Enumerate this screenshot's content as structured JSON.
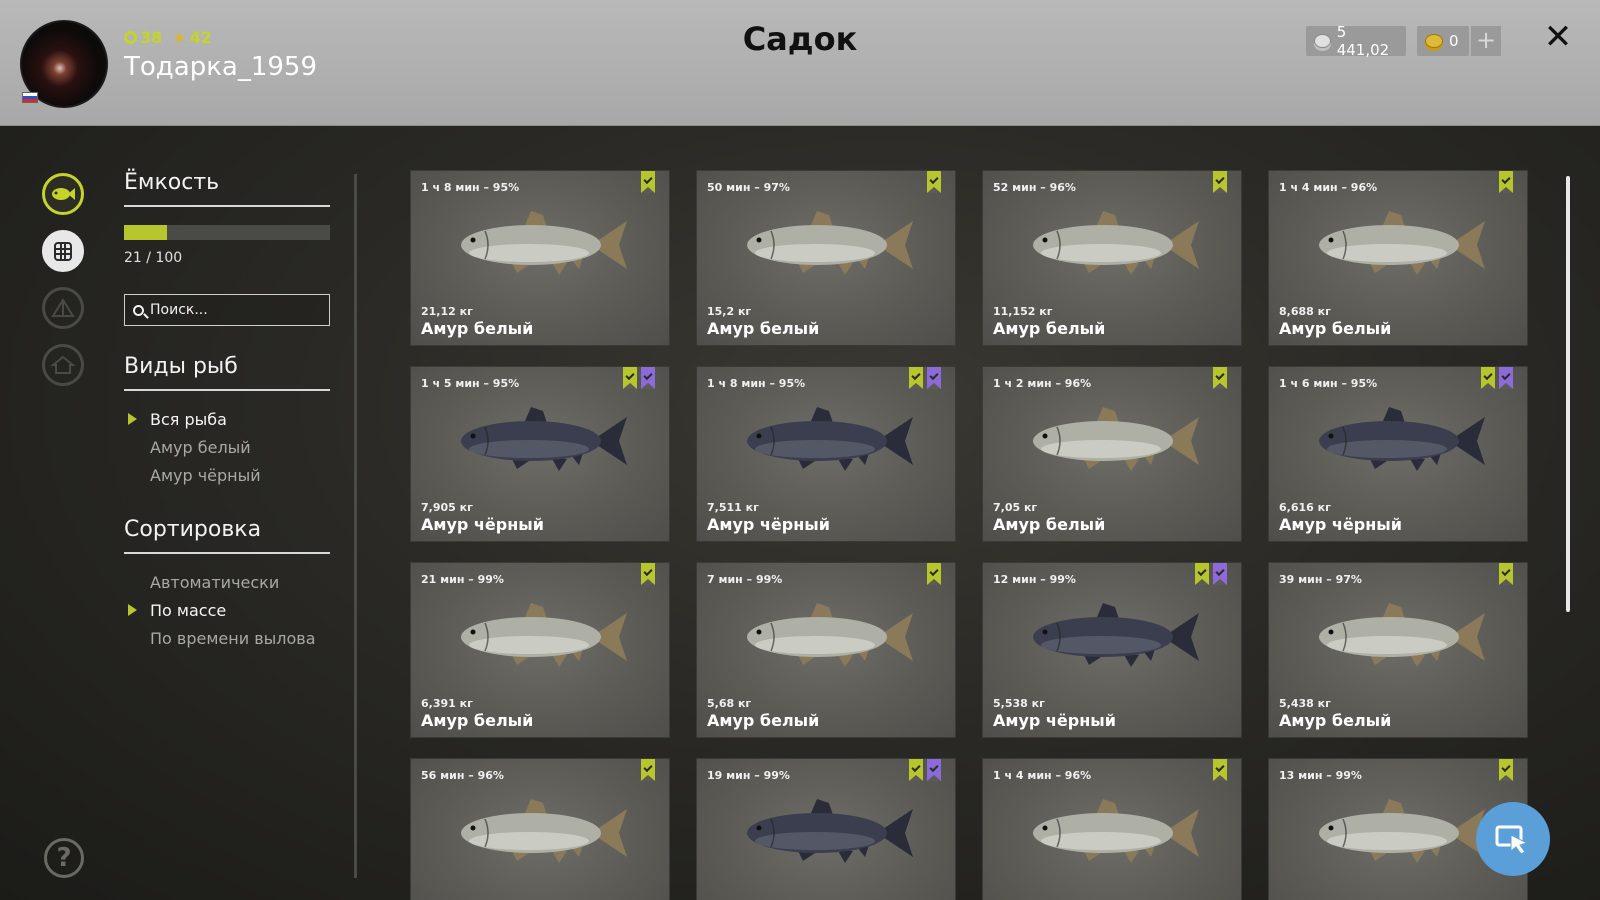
{
  "header": {
    "title": "Садок",
    "username": "Тодарка_1959",
    "level": "38",
    "rank": "42",
    "silver": "5 441,02",
    "gold": "0",
    "plus_label": "+",
    "close_label": "✕"
  },
  "capacity": {
    "title": "Ёмкость",
    "current": 21,
    "max": 100,
    "text": "21 / 100",
    "fill_fraction": 0.21
  },
  "search": {
    "placeholder": "Поиск..."
  },
  "species": {
    "title": "Виды рыб",
    "items": [
      {
        "label": "Вся рыба",
        "selected": true
      },
      {
        "label": "Амур белый",
        "selected": false
      },
      {
        "label": "Амур чёрный",
        "selected": false
      }
    ]
  },
  "sorting": {
    "title": "Сортировка",
    "items": [
      {
        "label": "Автоматически",
        "selected": false
      },
      {
        "label": "По массе",
        "selected": true
      },
      {
        "label": "По времени вылова",
        "selected": false
      }
    ]
  },
  "help_label": "?",
  "colors": {
    "accent": "#b6c62c",
    "purple_badge": "#8c6ad8",
    "fab": "#5a9fd8",
    "white_amur": "#aeb0a6",
    "black_amur": "#3a3e4e"
  },
  "fish": [
    {
      "time": "1 ч 8 мин – 95%",
      "weight": "21,12 кг",
      "name": "Амур белый",
      "kind": "white",
      "badges": [
        "green"
      ]
    },
    {
      "time": "50 мин – 97%",
      "weight": "15,2 кг",
      "name": "Амур белый",
      "kind": "white",
      "badges": [
        "green"
      ]
    },
    {
      "time": "52 мин – 96%",
      "weight": "11,152 кг",
      "name": "Амур белый",
      "kind": "white",
      "badges": [
        "green"
      ]
    },
    {
      "time": "1 ч 4 мин – 96%",
      "weight": "8,688 кг",
      "name": "Амур белый",
      "kind": "white",
      "badges": [
        "green"
      ]
    },
    {
      "time": "1 ч 5 мин – 95%",
      "weight": "7,905 кг",
      "name": "Амур чёрный",
      "kind": "black",
      "badges": [
        "green",
        "purple"
      ]
    },
    {
      "time": "1 ч 8 мин – 95%",
      "weight": "7,511 кг",
      "name": "Амур чёрный",
      "kind": "black",
      "badges": [
        "green",
        "purple"
      ]
    },
    {
      "time": "1 ч 2 мин – 96%",
      "weight": "7,05 кг",
      "name": "Амур белый",
      "kind": "white",
      "badges": [
        "green"
      ]
    },
    {
      "time": "1 ч 6 мин – 95%",
      "weight": "6,616 кг",
      "name": "Амур чёрный",
      "kind": "black",
      "badges": [
        "green",
        "purple"
      ]
    },
    {
      "time": "21 мин – 99%",
      "weight": "6,391 кг",
      "name": "Амур белый",
      "kind": "white",
      "badges": [
        "green"
      ]
    },
    {
      "time": "7 мин – 99%",
      "weight": "5,68 кг",
      "name": "Амур белый",
      "kind": "white",
      "badges": [
        "green"
      ]
    },
    {
      "time": "12 мин – 99%",
      "weight": "5,538 кг",
      "name": "Амур чёрный",
      "kind": "black",
      "badges": [
        "green",
        "purple"
      ]
    },
    {
      "time": "39 мин – 97%",
      "weight": "5,438 кг",
      "name": "Амур белый",
      "kind": "white",
      "badges": [
        "green"
      ]
    },
    {
      "time": "56 мин – 96%",
      "weight": "",
      "name": "",
      "kind": "white",
      "badges": [
        "green"
      ]
    },
    {
      "time": "19 мин – 99%",
      "weight": "",
      "name": "",
      "kind": "black",
      "badges": [
        "green",
        "purple"
      ]
    },
    {
      "time": "1 ч 4 мин – 96%",
      "weight": "",
      "name": "",
      "kind": "white",
      "badges": [
        "green"
      ]
    },
    {
      "time": "13 мин – 99%",
      "weight": "",
      "name": "",
      "kind": "white",
      "badges": [
        "green"
      ]
    }
  ]
}
